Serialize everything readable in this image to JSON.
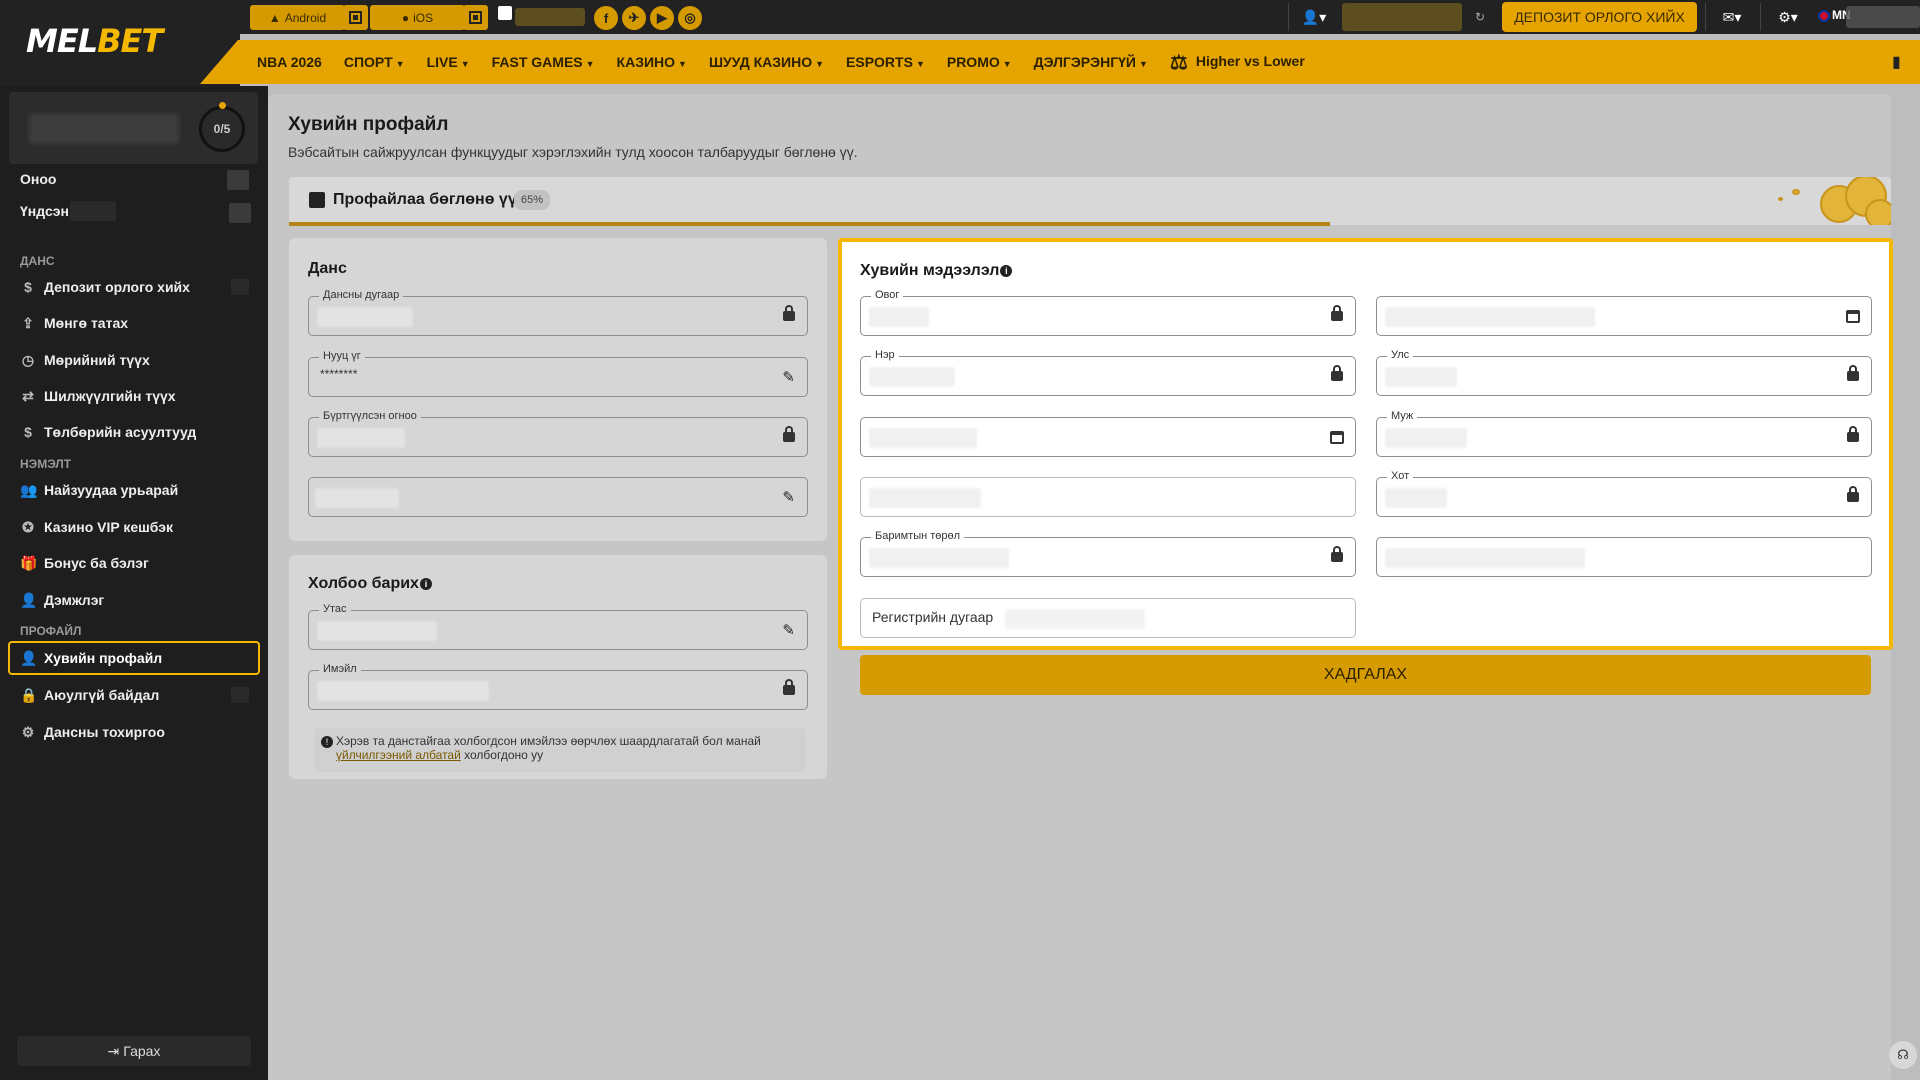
{
  "topbar": {
    "logo_main": "MEL",
    "logo_accent": "BET",
    "android": "Android",
    "ios": "iOS",
    "deposit_withdraw": "ДЕПОЗИТ ОРЛОГО ХИЙХ",
    "language": "MN",
    "social": [
      "f",
      "✈",
      "▶",
      "◎"
    ]
  },
  "nav": {
    "items": [
      {
        "label": "NBA 2026",
        "chevron": false
      },
      {
        "label": "СПОРТ",
        "chevron": true
      },
      {
        "label": "LIVE",
        "chevron": true
      },
      {
        "label": "FAST GAMES",
        "chevron": true
      },
      {
        "label": "КАЗИНО",
        "chevron": true
      },
      {
        "label": "ШУУД КАЗИНО",
        "chevron": true
      },
      {
        "label": "ESPORTS",
        "chevron": true
      },
      {
        "label": "PROMO",
        "chevron": true
      },
      {
        "label": "ДЭЛГЭРЭНГҮЙ",
        "chevron": true
      }
    ],
    "special": "Higher vs Lower"
  },
  "sidebar": {
    "progress": "0/5",
    "score_label": "Оноо",
    "main_label": "Үндсэн",
    "section_account": "ДАНС",
    "account_items": [
      "Депозит орлого хийх",
      "Мөнгө татах",
      "Мөрийний түүх",
      "Шилжүүлгийн түүх",
      "Төлбөрийн асуултууд"
    ],
    "section_extra": "НЭМЭЛТ",
    "extra_items": [
      "Найзуудаа урьарай",
      "Казино VIP кешбэк",
      "Бонус ба бэлэг",
      "Дэмжлэг"
    ],
    "section_profile": "ПРОФАЙЛ",
    "profile_items": [
      "Хувийн профайл",
      "Аюулгүй байдал",
      "Дансны тохиргоо"
    ],
    "logout": "Гарах"
  },
  "main": {
    "title": "Хувийн профайл",
    "subtitle": "Вэбсайтын сайжруулсан функцуудыг хэрэглэхийн тулд хоосон талбаруудыг бөглөнө үү.",
    "banner_title": "Профайлаа бөглөнө үү",
    "completion_percent": "65%",
    "completion_fraction": 0.65
  },
  "account_card": {
    "title": "Данс",
    "account_number_label": "Дансны дугаар",
    "password_label": "Нууц үг",
    "password_value": "********",
    "registered_label": "Бүртгүүлсэн огноо"
  },
  "contact_card": {
    "title": "Холбоо барих",
    "phone_label": "Утас",
    "email_label": "Имэйл",
    "note_text": "Хэрэв та данстайгаа холбогдсон имэйлээ өөрчлөх шаардлагатай бол манай",
    "note_link": "үйлчилгээний албатай",
    "note_end": "холбогдоно уу"
  },
  "personal_card": {
    "title": "Хувийн мэдээлэл",
    "surname_label": "Овог",
    "name_label": "Нэр",
    "country_label": "Улс",
    "region_label": "Муж",
    "city_label": "Хот",
    "doc_type_label": "Баримтын төрөл",
    "reg_number_label": "Регистрийн дугаар",
    "save": "ХАДГАЛАХ"
  }
}
